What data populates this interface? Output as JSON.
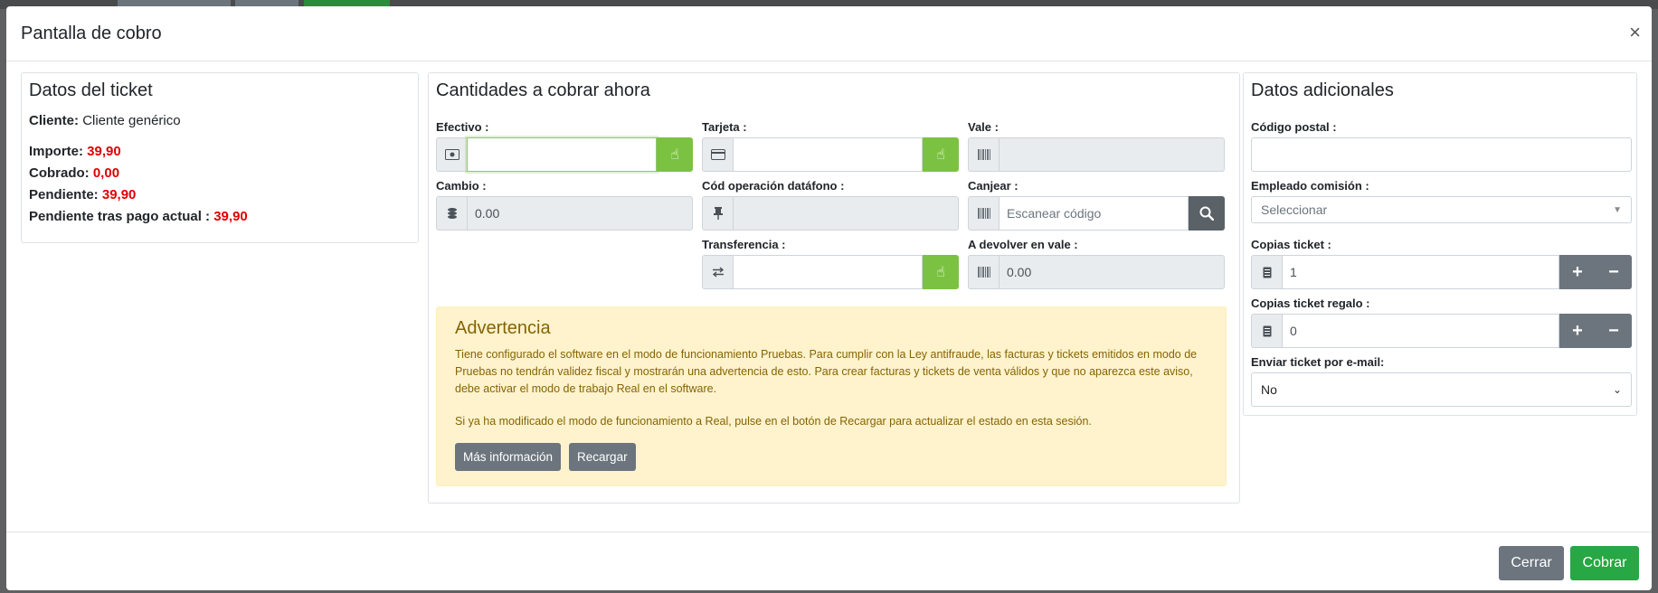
{
  "modal": {
    "title": "Pantalla de cobro",
    "close": "×"
  },
  "ticket": {
    "title": "Datos del ticket",
    "cliente_label": "Cliente:",
    "cliente_value": "Cliente genérico",
    "importe_label": "Importe:",
    "importe_value": "39,90",
    "cobrado_label": "Cobrado:",
    "cobrado_value": "0,00",
    "pendiente_label": "Pendiente:",
    "pendiente_value": "39,90",
    "pendiente_tras_label": "Pendiente tras pago actual :",
    "pendiente_tras_value": "39,90"
  },
  "cobro": {
    "title": "Cantidades a cobrar ahora",
    "efectivo_label": "Efectivo :",
    "efectivo_value": "",
    "tarjeta_label": "Tarjeta :",
    "tarjeta_value": "",
    "vale_label": "Vale :",
    "vale_value": "",
    "cambio_label": "Cambio :",
    "cambio_value": "0.00",
    "datafono_label": "Cód operación datáfono :",
    "datafono_value": "",
    "canjear_label": "Canjear :",
    "canjear_placeholder": "Escanear código",
    "transferencia_label": "Transferencia :",
    "transferencia_value": "",
    "devolver_label": "A devolver en vale :",
    "devolver_value": "0.00"
  },
  "warning": {
    "title": "Advertencia",
    "text1": "Tiene configurado el software en el modo de funcionamiento Pruebas. Para cumplir con la Ley antifraude, las facturas y tickets emitidos en modo de Pruebas no tendrán validez fiscal y mostrarán una advertencia de esto. Para crear facturas y tickets de venta válidos y que no aparezca este aviso, debe activar el modo de trabajo Real en el software.",
    "text2": "Si ya ha modificado el modo de funcionamiento a Real, pulse en el botón de Recargar para actualizar el estado en esta sesión.",
    "mas_info": "Más información",
    "recargar": "Recargar"
  },
  "adicional": {
    "title": "Datos adicionales",
    "cp_label": "Código postal :",
    "cp_value": "",
    "empleado_label": "Empleado comisión :",
    "empleado_placeholder": "Seleccionar",
    "copias_label": "Copias ticket :",
    "copias_value": "1",
    "copias_regalo_label": "Copias ticket regalo :",
    "copias_regalo_value": "0",
    "email_label": "Enviar ticket por e-mail:",
    "email_value": "No",
    "plus": "+",
    "minus": "−"
  },
  "footer": {
    "cerrar": "Cerrar",
    "cobrar": "Cobrar"
  },
  "colors": {
    "green": "#28a745",
    "secondary": "#6c757d",
    "accent_green": "#7cc242",
    "red": "#e00000",
    "warning_bg": "#fff3cd"
  },
  "icons": [
    "close-icon",
    "cash-icon",
    "hand-pointer-icon",
    "credit-card-icon",
    "barcode-icon",
    "coins-icon",
    "thumbtack-icon",
    "exchange-icon",
    "search-icon",
    "receipt-icon",
    "plus-icon",
    "minus-icon",
    "chevron-down-icon"
  ]
}
